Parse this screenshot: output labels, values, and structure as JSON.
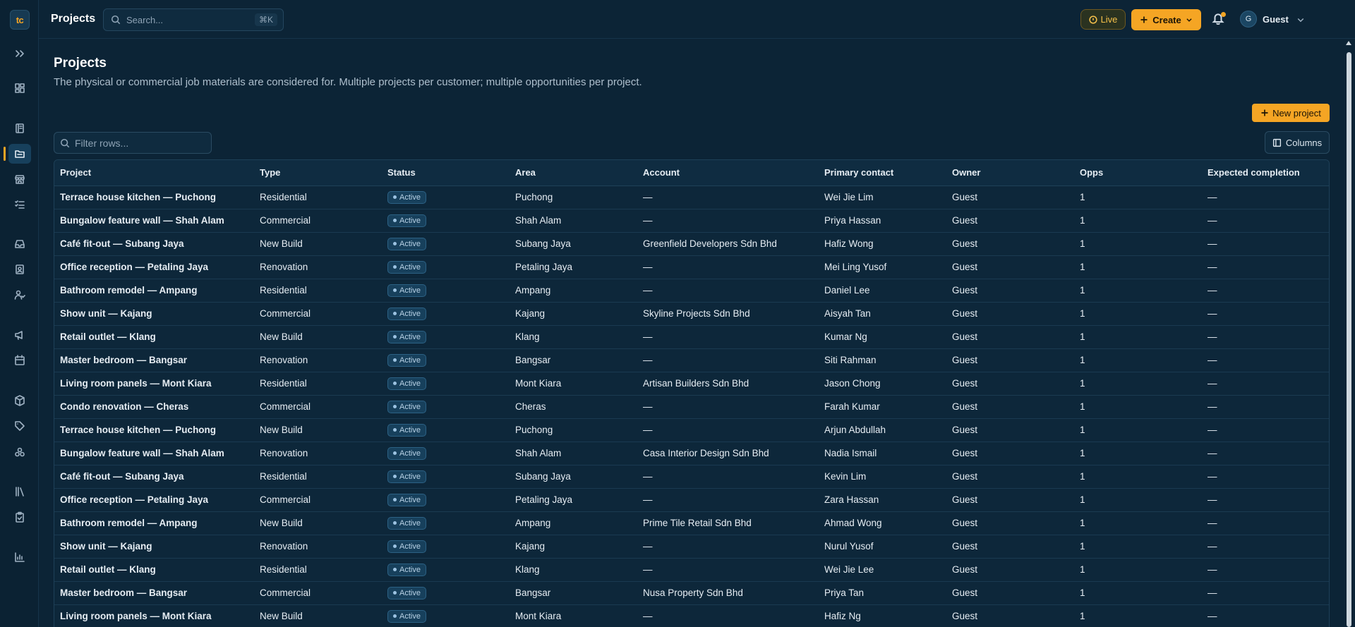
{
  "app": {
    "logo_text": "tc",
    "title": "Projects",
    "search_placeholder": "Search...",
    "search_shortcut": "⌘K",
    "live_label": "Live",
    "create_label": "Create",
    "user": {
      "initial": "G",
      "name": "Guest"
    }
  },
  "sidebar": {
    "items": [
      {
        "icon": "expand-icon"
      },
      {
        "icon": "dashboard-icon"
      },
      {
        "icon": "notebook-icon"
      },
      {
        "icon": "projects-folder-icon",
        "active": true
      },
      {
        "icon": "store-icon"
      },
      {
        "icon": "checklist-icon"
      },
      {
        "icon": "inbox-icon"
      },
      {
        "icon": "contact-card-icon"
      },
      {
        "icon": "users-icon"
      },
      {
        "icon": "megaphone-icon"
      },
      {
        "icon": "calendar-icon"
      },
      {
        "icon": "box-icon"
      },
      {
        "icon": "tags-icon"
      },
      {
        "icon": "stack-icon"
      },
      {
        "icon": "library-icon"
      },
      {
        "icon": "clipboard-check-icon"
      },
      {
        "icon": "bar-chart-icon"
      }
    ]
  },
  "page": {
    "title": "Projects",
    "description": "The physical or commercial job materials are considered for. Multiple projects per customer; multiple opportunities per project.",
    "new_project_label": "New project",
    "filter_placeholder": "Filter rows...",
    "columns_label": "Columns"
  },
  "colors": {
    "accent": "#f5a524",
    "background": "#0c2436",
    "badge": "#17405c"
  },
  "table": {
    "headers": [
      "Project",
      "Type",
      "Status",
      "Area",
      "Account",
      "Primary contact",
      "Owner",
      "Opps",
      "Expected completion"
    ],
    "rows": [
      [
        "Terrace house kitchen — Puchong",
        "Residential",
        "Active",
        "Puchong",
        "—",
        "Wei Jie Lim",
        "Guest",
        "1",
        "—"
      ],
      [
        "Bungalow feature wall — Shah Alam",
        "Commercial",
        "Active",
        "Shah Alam",
        "—",
        "Priya Hassan",
        "Guest",
        "1",
        "—"
      ],
      [
        "Café fit-out — Subang Jaya",
        "New Build",
        "Active",
        "Subang Jaya",
        "Greenfield Developers Sdn Bhd",
        "Hafiz Wong",
        "Guest",
        "1",
        "—"
      ],
      [
        "Office reception — Petaling Jaya",
        "Renovation",
        "Active",
        "Petaling Jaya",
        "—",
        "Mei Ling Yusof",
        "Guest",
        "1",
        "—"
      ],
      [
        "Bathroom remodel — Ampang",
        "Residential",
        "Active",
        "Ampang",
        "—",
        "Daniel Lee",
        "Guest",
        "1",
        "—"
      ],
      [
        "Show unit — Kajang",
        "Commercial",
        "Active",
        "Kajang",
        "Skyline Projects Sdn Bhd",
        "Aisyah Tan",
        "Guest",
        "1",
        "—"
      ],
      [
        "Retail outlet — Klang",
        "New Build",
        "Active",
        "Klang",
        "—",
        "Kumar Ng",
        "Guest",
        "1",
        "—"
      ],
      [
        "Master bedroom — Bangsar",
        "Renovation",
        "Active",
        "Bangsar",
        "—",
        "Siti Rahman",
        "Guest",
        "1",
        "—"
      ],
      [
        "Living room panels — Mont Kiara",
        "Residential",
        "Active",
        "Mont Kiara",
        "Artisan Builders Sdn Bhd",
        "Jason Chong",
        "Guest",
        "1",
        "—"
      ],
      [
        "Condo renovation — Cheras",
        "Commercial",
        "Active",
        "Cheras",
        "—",
        "Farah Kumar",
        "Guest",
        "1",
        "—"
      ],
      [
        "Terrace house kitchen — Puchong",
        "New Build",
        "Active",
        "Puchong",
        "—",
        "Arjun Abdullah",
        "Guest",
        "1",
        "—"
      ],
      [
        "Bungalow feature wall — Shah Alam",
        "Renovation",
        "Active",
        "Shah Alam",
        "Casa Interior Design Sdn Bhd",
        "Nadia Ismail",
        "Guest",
        "1",
        "—"
      ],
      [
        "Café fit-out — Subang Jaya",
        "Residential",
        "Active",
        "Subang Jaya",
        "—",
        "Kevin Lim",
        "Guest",
        "1",
        "—"
      ],
      [
        "Office reception — Petaling Jaya",
        "Commercial",
        "Active",
        "Petaling Jaya",
        "—",
        "Zara Hassan",
        "Guest",
        "1",
        "—"
      ],
      [
        "Bathroom remodel — Ampang",
        "New Build",
        "Active",
        "Ampang",
        "Prime Tile Retail Sdn Bhd",
        "Ahmad Wong",
        "Guest",
        "1",
        "—"
      ],
      [
        "Show unit — Kajang",
        "Renovation",
        "Active",
        "Kajang",
        "—",
        "Nurul Yusof",
        "Guest",
        "1",
        "—"
      ],
      [
        "Retail outlet — Klang",
        "Residential",
        "Active",
        "Klang",
        "—",
        "Wei Jie Lee",
        "Guest",
        "1",
        "—"
      ],
      [
        "Master bedroom — Bangsar",
        "Commercial",
        "Active",
        "Bangsar",
        "Nusa Property Sdn Bhd",
        "Priya Tan",
        "Guest",
        "1",
        "—"
      ],
      [
        "Living room panels — Mont Kiara",
        "New Build",
        "Active",
        "Mont Kiara",
        "—",
        "Hafiz Ng",
        "Guest",
        "1",
        "—"
      ]
    ]
  }
}
